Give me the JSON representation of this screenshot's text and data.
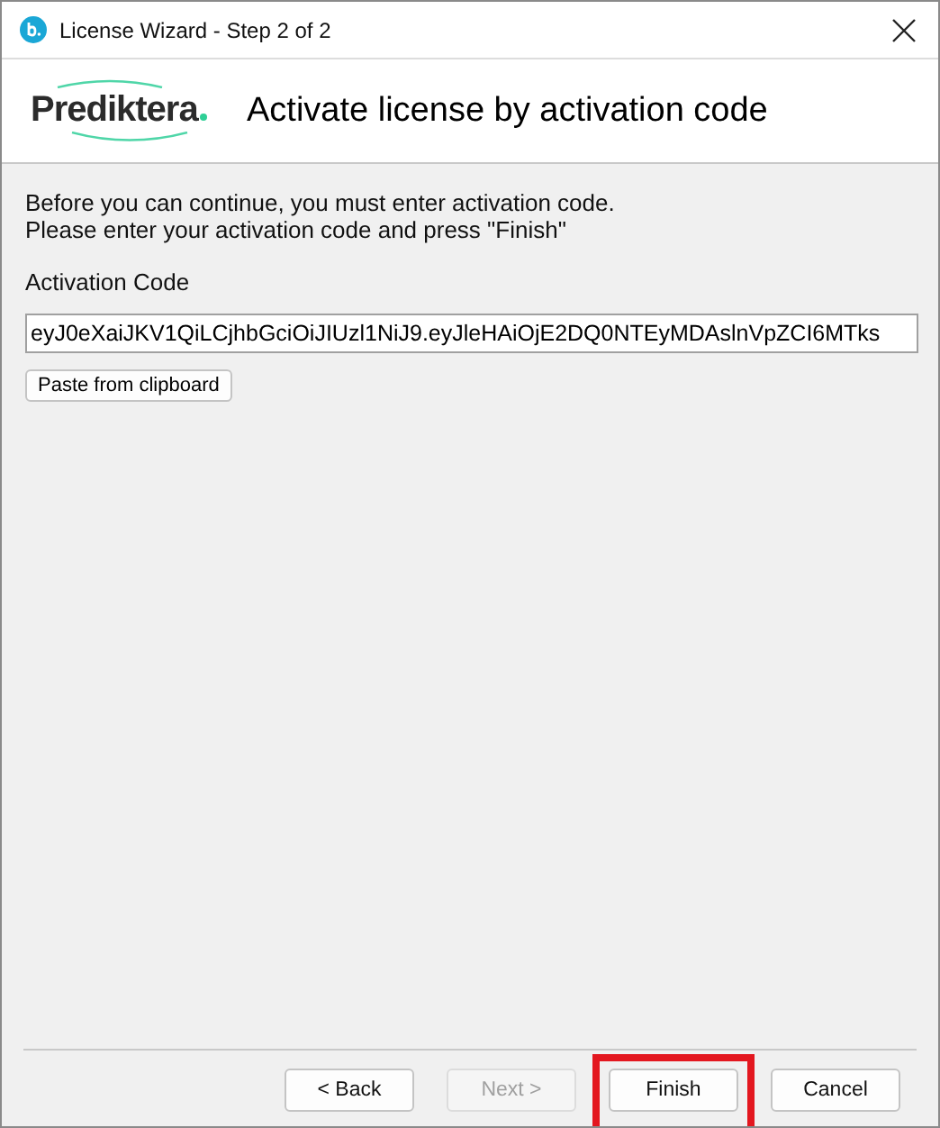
{
  "window": {
    "title": "License Wizard - Step 2 of 2"
  },
  "header": {
    "logo": "Prediktera",
    "title": "Activate license by activation code"
  },
  "intro": [
    "Before you can continue, you must enter activation code.",
    "Please enter your activation code and press \"Finish\""
  ],
  "activation_code": {
    "label": "Activation Code",
    "value": "eyJ0eXaiJKV1QiLCjhbGciOiJIUzl1NiJ9.eyJleHAiOjE2DQ0NTEyMDAslnVpZCI6MTks"
  },
  "paste_button": "Paste from clipboard",
  "buttons": [
    {
      "label": "< Back",
      "disabled": false,
      "highlighted": false
    },
    {
      "label": "Next >",
      "disabled": true,
      "highlighted": false
    },
    {
      "label": "Finish",
      "disabled": false,
      "highlighted": true
    },
    {
      "label": "Cancel",
      "disabled": false,
      "highlighted": false
    }
  ]
}
